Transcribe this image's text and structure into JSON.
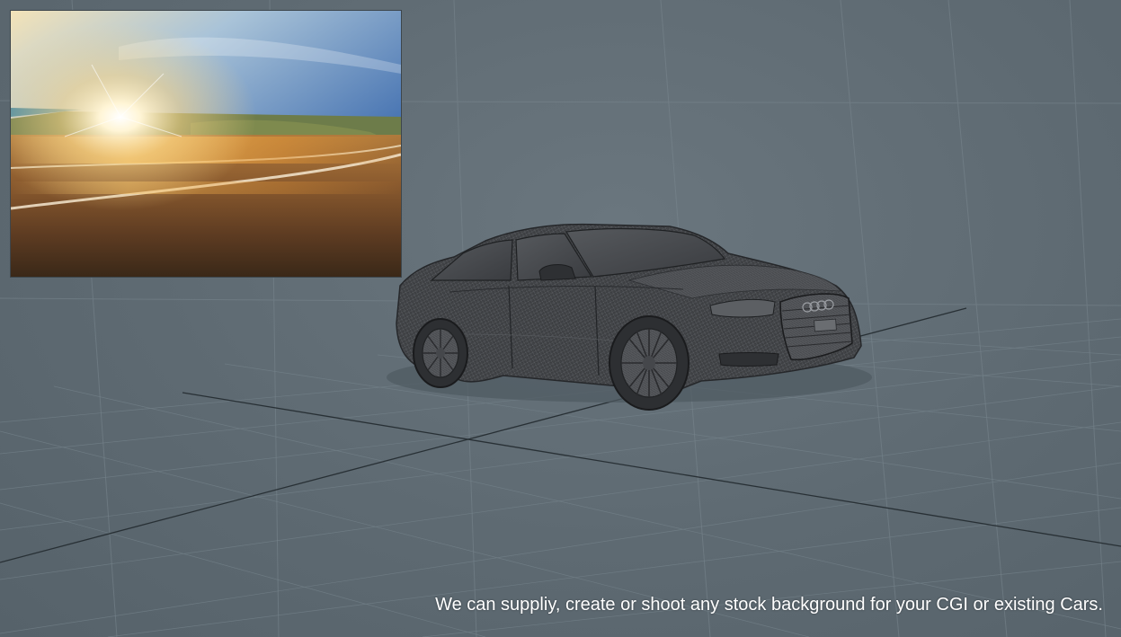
{
  "caption": "We can suppliy, create or shoot any stock background for your CGI or existing Cars.",
  "colors": {
    "viewport_bg": "#5f6c74",
    "grid_line": "#7f8d95",
    "grid_major": "#2f383d",
    "car_body": "#3b3d40",
    "caption_text": "#ffffff"
  },
  "icons": {
    "background_preview": "sunset-road-photo",
    "vehicle": "wireframe-sedan-model"
  }
}
